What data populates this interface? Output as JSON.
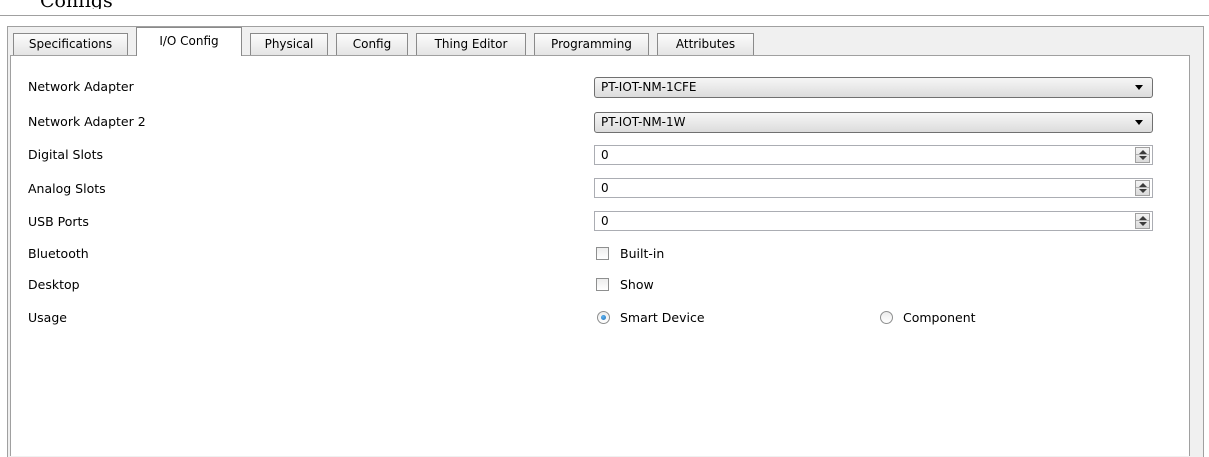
{
  "window": {
    "title": "Configs"
  },
  "tabs": [
    {
      "label": "Specifications"
    },
    {
      "label": "I/O Config"
    },
    {
      "label": "Physical"
    },
    {
      "label": "Config"
    },
    {
      "label": "Thing Editor"
    },
    {
      "label": "Programming"
    },
    {
      "label": "Attributes"
    }
  ],
  "active_tab": "I/O Config",
  "fields": {
    "network_adapter": {
      "label": "Network Adapter",
      "value": "PT-IOT-NM-1CFE"
    },
    "network_adapter_2": {
      "label": "Network Adapter 2",
      "value": "PT-IOT-NM-1W"
    },
    "digital_slots": {
      "label": "Digital Slots",
      "value": "0"
    },
    "analog_slots": {
      "label": "Analog Slots",
      "value": "0"
    },
    "usb_ports": {
      "label": "USB Ports",
      "value": "0"
    },
    "bluetooth": {
      "label": "Bluetooth",
      "option_label": "Built-in",
      "checked": false
    },
    "desktop": {
      "label": "Desktop",
      "option_label": "Show",
      "checked": false
    },
    "usage": {
      "label": "Usage",
      "options": [
        {
          "label": "Smart Device",
          "selected": true
        },
        {
          "label": "Component",
          "selected": false
        }
      ]
    }
  },
  "colors": {
    "radio_selected": "#1d6fb8",
    "frame": "#a0a0a0",
    "tab_strip_bg": "#f0f0f0"
  }
}
